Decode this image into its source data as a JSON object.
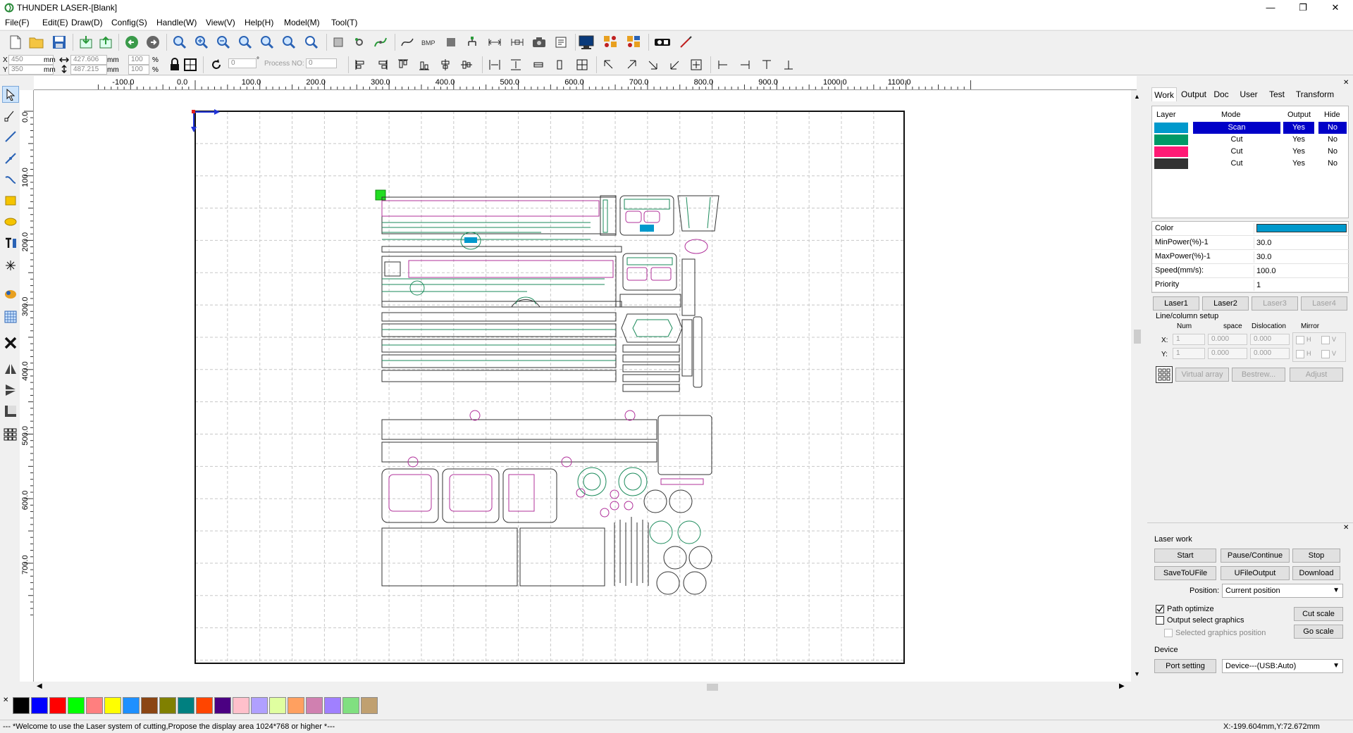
{
  "window": {
    "title": "THUNDER LASER-[Blank]",
    "minimize": "—",
    "maximize": "❐",
    "close": "✕"
  },
  "menu": [
    "File(F)",
    "Edit(E)",
    "Draw(D)",
    "Config(S)",
    "Handle(W)",
    "View(V)",
    "Help(H)",
    "Model(M)",
    "Tool(T)"
  ],
  "coords": {
    "x_label": "X",
    "y_label": "Y",
    "x_value": "450",
    "y_value": "350",
    "unit": "mm",
    "width_value": "427.606",
    "height_value": "487.215",
    "scale_x": "100",
    "scale_y": "100",
    "percent": "%",
    "rotate_value": "0",
    "degree": "°",
    "process_label": "Process NO:",
    "process_value": "0"
  },
  "ruler": {
    "top_ticks": [
      "-100.0",
      "0.0",
      "100.0",
      "200.0",
      "300.0",
      "400.0",
      "500.0",
      "600.0",
      "700.0",
      "800.0",
      "900.0",
      "1000.0",
      "1100.0"
    ],
    "left_ticks": [
      "0.0",
      "100.0",
      "200.0",
      "300.0",
      "400.0",
      "500.0",
      "600.0",
      "700.0"
    ]
  },
  "palette": [
    "#000000",
    "#0000ff",
    "#ff0000",
    "#00ff00",
    "#ff7f7f",
    "#ffff00",
    "#1e90ff",
    "#8b4513",
    "#808000",
    "#008080",
    "#ff4500",
    "#4b0082",
    "#ffc0cb",
    "#b0a0ff",
    "#e0ffa0",
    "#ffa060",
    "#d080b0",
    "#a080ff",
    "#80e080",
    "#c0a070"
  ],
  "palette_close": "✕",
  "status": {
    "message": "--- *Welcome to use the Laser system of cutting,Propose the display area 1024*768 or higher *---",
    "position": "X:-199.604mm,Y:72.672mm"
  },
  "panel": {
    "close": "✕",
    "tabs": [
      "Work",
      "Output",
      "Doc",
      "User",
      "Test",
      "Transform"
    ],
    "layer_headers": {
      "layer": "Layer",
      "mode": "Mode",
      "output": "Output",
      "hide": "Hide"
    },
    "layers": [
      {
        "color": "#0099cc",
        "mode": "Scan",
        "output": "Yes",
        "hide": "No",
        "selected": true
      },
      {
        "color": "#009966",
        "mode": "Cut",
        "output": "Yes",
        "hide": "No",
        "selected": false
      },
      {
        "color": "#ff1a75",
        "mode": "Cut",
        "output": "Yes",
        "hide": "No",
        "selected": false
      },
      {
        "color": "#333333",
        "mode": "Cut",
        "output": "Yes",
        "hide": "No",
        "selected": false
      }
    ],
    "props": {
      "color_label": "Color",
      "color_value": "#0099cc",
      "minpower_label": "MinPower(%)-1",
      "minpower_value": "30.0",
      "maxpower_label": "MaxPower(%)-1",
      "maxpower_value": "30.0",
      "speed_label": "Speed(mm/s):",
      "speed_value": "100.0",
      "priority_label": "Priority",
      "priority_value": "1"
    },
    "laser_tabs": [
      "Laser1",
      "Laser2",
      "Laser3",
      "Laser4"
    ],
    "linecol": {
      "title": "Line/column setup",
      "num": "Num",
      "space": "space",
      "dislocation": "Dislocation",
      "mirror": "Mirror",
      "x_label": "X:",
      "y_label": "Y:",
      "x_num": "1",
      "x_space": "0.000",
      "x_disloc": "0.000",
      "y_num": "1",
      "y_space": "0.000",
      "y_disloc": "0.000",
      "h": "H",
      "v": "V",
      "virtual_array": "Virtual array",
      "bestrew": "Bestrew...",
      "adjust": "Adjust"
    },
    "laserwork": {
      "close": "✕",
      "title": "Laser work",
      "start": "Start",
      "pause": "Pause/Continue",
      "stop": "Stop",
      "save_ufile": "SaveToUFile",
      "ufile_output": "UFileOutput",
      "download": "Download",
      "position_label": "Position:",
      "position_value": "Current position",
      "path_optimize": "Path optimize",
      "output_select": "Output select graphics",
      "selected_position": "Selected graphics position",
      "cut_scale": "Cut scale",
      "go_scale": "Go scale",
      "device_title": "Device",
      "port_setting": "Port setting",
      "device_value": "Device---(USB:Auto)"
    }
  }
}
